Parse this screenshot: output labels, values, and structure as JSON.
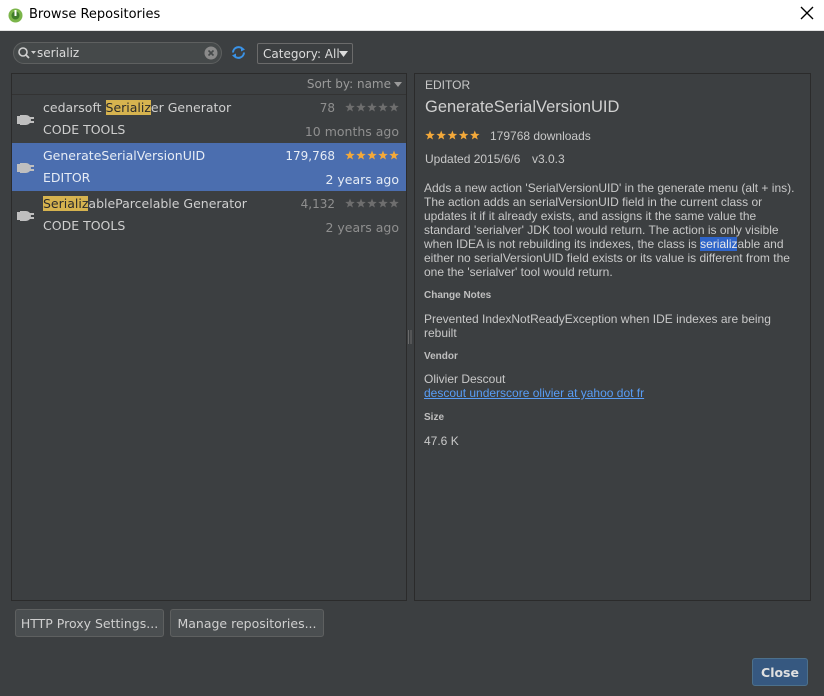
{
  "window": {
    "title": "Browse Repositories"
  },
  "search": {
    "value": "serializ"
  },
  "category": {
    "label": "Category: All"
  },
  "list": {
    "sort_label": "Sort by: name",
    "items": [
      {
        "name_pre": "cedarsoft ",
        "name_hl": "Serializ",
        "name_post": "er Generator",
        "category": "CODE TOOLS",
        "downloads": "78",
        "date": "10 months ago",
        "rating": 0,
        "selected": false
      },
      {
        "name_pre": "GenerateSerialVersionUID",
        "name_hl": "",
        "name_post": "",
        "category": "EDITOR",
        "downloads": "179,768",
        "date": "2 years ago",
        "rating": 5,
        "selected": true
      },
      {
        "name_pre": "",
        "name_hl": "Serializ",
        "name_post": "ableParcelable Generator",
        "category": "CODE TOOLS",
        "downloads": "4,132",
        "date": "2 years ago",
        "rating": 0,
        "selected": false
      }
    ]
  },
  "detail": {
    "category": "EDITOR",
    "title": "GenerateSerialVersionUID",
    "rating": 5,
    "downloads": "179768 downloads",
    "updated": "Updated 2015/6/6",
    "version": "v3.0.3",
    "description_pre": "Adds a new action 'SerialVersionUID' in the generate menu (alt + ins). The action adds an serialVersionUID field in the current class or updates it if it already exists, and assigns it the same value the standard 'serialver' JDK tool would return. The action is only visible when IDEA is not rebuilding its indexes, the class is ",
    "description_hl": "serializ",
    "description_post": "able and either no serialVersionUID field exists or its value is different from the one the 'serialver' tool would return.",
    "change_notes_heading": "Change Notes",
    "change_notes": "Prevented IndexNotReadyException when IDE indexes are being rebuilt",
    "vendor_heading": "Vendor",
    "vendor_name": "Olivier Descout",
    "vendor_link": "descout underscore olivier at yahoo dot fr",
    "size_heading": "Size",
    "size": "47.6 K"
  },
  "buttons": {
    "http_proxy": "HTTP Proxy Settings...",
    "manage_repos": "Manage repositories...",
    "close": "Close"
  },
  "colors": {
    "background": "#3c3f41",
    "selection": "#4b6eaf",
    "highlight": "#d6b34f",
    "star_on": "#f4a93a",
    "star_off": "#6e6e6e",
    "link": "#589df6",
    "primary_button": "#365880"
  },
  "icons": {
    "app": "android-studio-icon",
    "search": "search-icon",
    "clear": "clear-icon",
    "refresh": "refresh-icon",
    "plugin": "plugin-icon",
    "close": "close-icon"
  }
}
